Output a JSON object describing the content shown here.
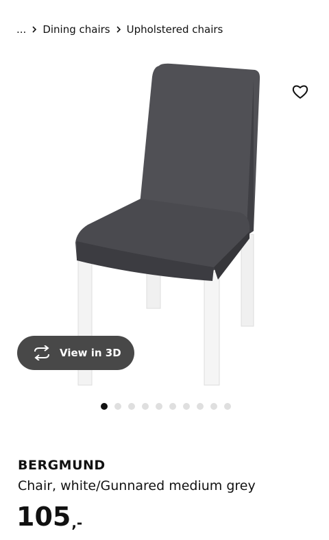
{
  "breadcrumb": {
    "ellipsis": "...",
    "items": [
      "Dining chairs",
      "Upholstered chairs"
    ]
  },
  "product": {
    "name": "BERGMUND",
    "description": "Chair, white/Gunnared medium grey",
    "price_amount": "105",
    "price_suffix": ",-"
  },
  "actions": {
    "view_3d_label": "View in 3D",
    "favorite_icon": "heart-icon"
  },
  "gallery": {
    "image_count": 10,
    "active_index": 0
  },
  "colors": {
    "accent_dark": "#484848",
    "upholstery_grey": "#4e4e52",
    "dot_inactive": "#dfdfdf",
    "dot_active": "#111111"
  }
}
